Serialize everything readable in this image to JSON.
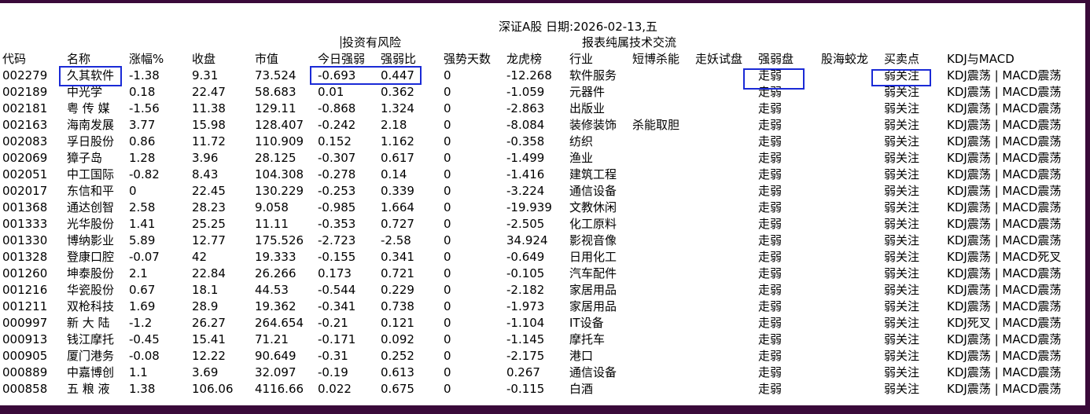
{
  "header": {
    "title": "深证A股 日期:2026-02-13,五",
    "subtitle_risk": "投资有风险",
    "subtitle_report": "报表纯属技术交流"
  },
  "columns": [
    "代码",
    "名称",
    "涨幅%",
    "收盘",
    "市值",
    "今日强弱",
    "强弱比",
    "强势天数",
    "龙虎榜",
    "行业",
    "短博杀能",
    "走妖试盘",
    "强弱盘",
    "股海蛟龙",
    "买卖点",
    "KDJ与MACD"
  ],
  "rows": [
    [
      "002279",
      "久其软件",
      "-1.38",
      "9.31",
      "73.524",
      "-0.693",
      "0.447",
      "0",
      "-12.268",
      "软件服务",
      "",
      "",
      "走弱",
      "",
      "弱关注",
      "KDJ震荡 | MACD震荡"
    ],
    [
      "002189",
      "中光学",
      "0.18",
      "22.47",
      "58.683",
      "0.01",
      "0.362",
      "0",
      "-1.059",
      "元器件",
      "",
      "",
      "走弱",
      "",
      "弱关注",
      "KDJ震荡 | MACD震荡"
    ],
    [
      "002181",
      "粤 传 媒",
      "-1.56",
      "11.38",
      "129.11",
      "-0.868",
      "1.324",
      "0",
      "-2.863",
      "出版业",
      "",
      "",
      "走弱",
      "",
      "弱关注",
      "KDJ震荡 | MACD震荡"
    ],
    [
      "002163",
      "海南发展",
      "3.77",
      "15.98",
      "128.407",
      "-0.242",
      "2.18",
      "0",
      "-8.084",
      "装修装饰",
      "杀能取胆",
      "",
      "走弱",
      "",
      "弱关注",
      "KDJ震荡 | MACD震荡"
    ],
    [
      "002083",
      "孚日股份",
      "0.86",
      "11.72",
      "110.909",
      "0.152",
      "1.162",
      "0",
      "-0.358",
      "纺织",
      "",
      "",
      "走弱",
      "",
      "弱关注",
      "KDJ震荡 | MACD震荡"
    ],
    [
      "002069",
      "獐子岛",
      "1.28",
      "3.96",
      "28.125",
      "-0.307",
      "0.617",
      "0",
      "-1.499",
      "渔业",
      "",
      "",
      "走弱",
      "",
      "弱关注",
      "KDJ震荡 | MACD震荡"
    ],
    [
      "002051",
      "中工国际",
      "-0.82",
      "8.43",
      "104.308",
      "-0.278",
      "0.14",
      "0",
      "-1.416",
      "建筑工程",
      "",
      "",
      "走弱",
      "",
      "弱关注",
      "KDJ震荡 | MACD震荡"
    ],
    [
      "002017",
      "东信和平",
      "0",
      "22.45",
      "130.229",
      "-0.253",
      "0.339",
      "0",
      "-3.224",
      "通信设备",
      "",
      "",
      "走弱",
      "",
      "弱关注",
      "KDJ震荡 | MACD震荡"
    ],
    [
      "001368",
      "通达创智",
      "2.58",
      "28.23",
      "9.058",
      "-0.985",
      "1.664",
      "0",
      "-19.939",
      "文教休闲",
      "",
      "",
      "走弱",
      "",
      "弱关注",
      "KDJ震荡 | MACD震荡"
    ],
    [
      "001333",
      "光华股份",
      "1.41",
      "25.25",
      "11.11",
      "-0.353",
      "0.727",
      "0",
      "-2.505",
      "化工原料",
      "",
      "",
      "走弱",
      "",
      "弱关注",
      "KDJ震荡 | MACD震荡"
    ],
    [
      "001330",
      "博纳影业",
      "5.89",
      "12.77",
      "175.526",
      "-2.723",
      "-2.58",
      "0",
      "34.924",
      "影视音像",
      "",
      "",
      "走弱",
      "",
      "弱关注",
      "KDJ震荡 | MACD震荡"
    ],
    [
      "001328",
      "登康口腔",
      "-0.07",
      "42",
      "19.333",
      "-0.155",
      "0.341",
      "0",
      "-0.649",
      "日用化工",
      "",
      "",
      "走弱",
      "",
      "弱关注",
      "KDJ震荡 | MACD死叉"
    ],
    [
      "001260",
      "坤泰股份",
      "2.1",
      "22.84",
      "26.266",
      "0.173",
      "0.721",
      "0",
      "-0.105",
      "汽车配件",
      "",
      "",
      "走弱",
      "",
      "弱关注",
      "KDJ震荡 | MACD震荡"
    ],
    [
      "001216",
      "华瓷股份",
      "0.67",
      "18.1",
      "44.53",
      "-0.544",
      "0.229",
      "0",
      "-2.182",
      "家居用品",
      "",
      "",
      "走弱",
      "",
      "弱关注",
      "KDJ震荡 | MACD震荡"
    ],
    [
      "001211",
      "双枪科技",
      "1.69",
      "28.9",
      "19.362",
      "-0.341",
      "0.738",
      "0",
      "-1.973",
      "家居用品",
      "",
      "",
      "走弱",
      "",
      "弱关注",
      "KDJ震荡 | MACD震荡"
    ],
    [
      "000997",
      "新 大 陆",
      "-1.2",
      "26.27",
      "264.654",
      "-0.21",
      "0.121",
      "0",
      "-1.104",
      "IT设备",
      "",
      "",
      "走弱",
      "",
      "弱关注",
      "KDJ死叉 | MACD震荡"
    ],
    [
      "000913",
      "钱江摩托",
      "-0.45",
      "15.41",
      "71.21",
      "-0.171",
      "0.092",
      "0",
      "-1.145",
      "摩托车",
      "",
      "",
      "走弱",
      "",
      "弱关注",
      "KDJ震荡 | MACD震荡"
    ],
    [
      "000905",
      "厦门港务",
      "-0.08",
      "12.22",
      "90.649",
      "-0.31",
      "0.252",
      "0",
      "-2.175",
      "港口",
      "",
      "",
      "走弱",
      "",
      "弱关注",
      "KDJ震荡 | MACD震荡"
    ],
    [
      "000889",
      "中嘉博创",
      "1.1",
      "3.69",
      "32.097",
      "-0.19",
      "0.613",
      "0",
      "0.267",
      "通信设备",
      "",
      "",
      "走弱",
      "",
      "弱关注",
      "KDJ震荡 | MACD震荡"
    ],
    [
      "000858",
      "五 粮 液",
      "1.38",
      "106.06",
      "4116.66",
      "0.022",
      "0.675",
      "0",
      "-0.115",
      "白酒",
      "",
      "",
      "走弱",
      "",
      "弱关注",
      "KDJ震荡 | MACD震荡"
    ]
  ],
  "colors": {
    "highlight": "#1a2ad6",
    "frame": "#3a0a3a",
    "background": "#ffffff"
  }
}
